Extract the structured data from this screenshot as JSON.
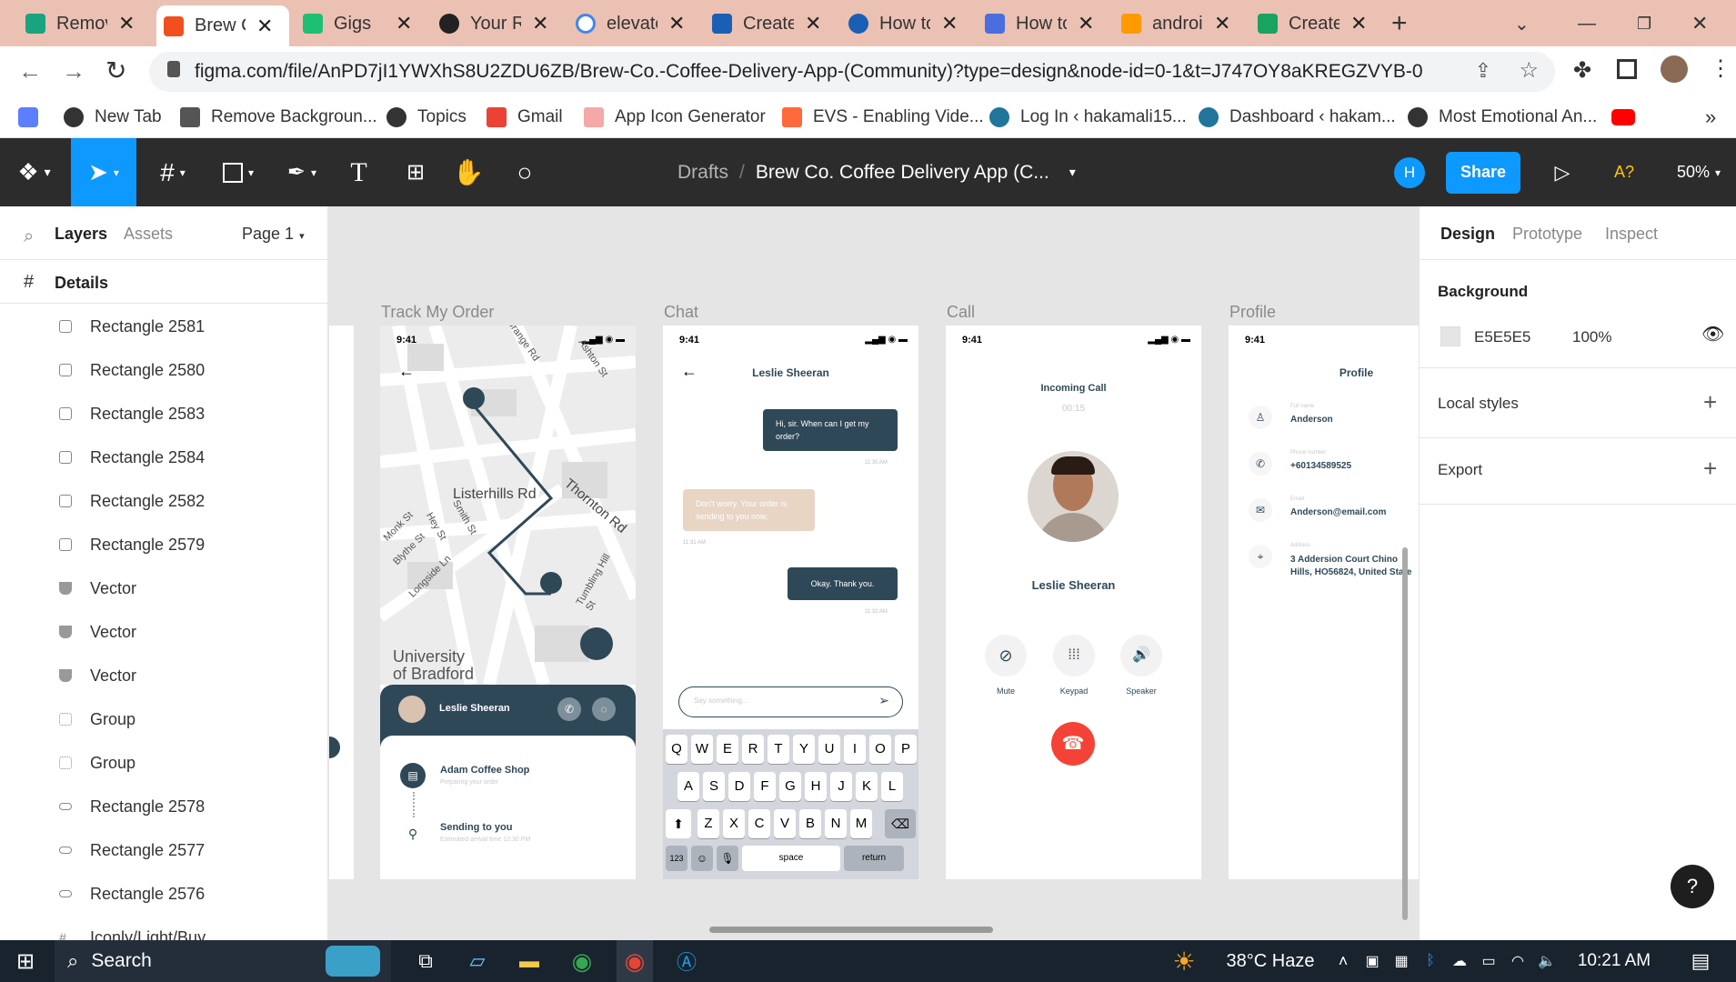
{
  "browser": {
    "tabs": [
      {
        "title": "Remov",
        "color": "#19a37f"
      },
      {
        "title": "Brew C",
        "color": "#f24e1e"
      },
      {
        "title": "Gigs",
        "color": "#1dbf73"
      },
      {
        "title": "Your R",
        "color": "#222222"
      },
      {
        "title": "elevate",
        "color": "#4285f4"
      },
      {
        "title": "Create",
        "color": "#1a5fb4"
      },
      {
        "title": "How to",
        "color": "#1a5fb4"
      },
      {
        "title": "How to",
        "color": "#4a6ee0"
      },
      {
        "title": "androi",
        "color": "#ff9a00"
      },
      {
        "title": "Create",
        "color": "#1aa260"
      }
    ],
    "url": "figma.com/file/AnPD7jI1YWXhS8U2ZDU6ZB/Brew-Co.-Coffee-Delivery-App-(Community)?type=design&node-id=0-1&t=J747OY8aKREGZVYB-0",
    "bookmarks": [
      "New Tab",
      "Remove Backgroun...",
      "Topics",
      "Gmail",
      "App Icon Generator",
      "EVS - Enabling Vide...",
      "Log In ‹ hakamali15...",
      "Dashboard ‹ hakam...",
      "Most Emotional An..."
    ],
    "more": "»"
  },
  "figma": {
    "breadcrumb": {
      "folder": "Drafts",
      "sep": "/",
      "file": "Brew Co. Coffee Delivery App (C..."
    },
    "avatar_letter": "H",
    "share": "Share",
    "a11y": "A?",
    "zoom": "50%"
  },
  "left": {
    "tabs": {
      "layers": "Layers",
      "assets": "Assets",
      "page": "Page 1"
    },
    "frame_name": "Details",
    "layers": [
      "Rectangle 2581",
      "Rectangle 2580",
      "Rectangle 2583",
      "Rectangle 2584",
      "Rectangle 2582",
      "Rectangle 2579",
      "Vector",
      "Vector",
      "Vector",
      "Group",
      "Group",
      "Rectangle 2578",
      "Rectangle 2577",
      "Rectangle 2576",
      "Iconly/Light/Buy"
    ]
  },
  "right": {
    "tabs": {
      "design": "Design",
      "prototype": "Prototype",
      "inspect": "Inspect"
    },
    "background_label": "Background",
    "bg_hex": "E5E5E5",
    "bg_opacity": "100%",
    "local_styles": "Local styles",
    "export": "Export",
    "help": "?"
  },
  "frames": {
    "track": {
      "title": "Track My Order",
      "time": "9:41",
      "streets": [
        "Listerhills Rd",
        "Thornton Rd",
        "Smith St",
        "Hey St",
        "Blythe St",
        "Longside Ln",
        "Tumbling Hill St",
        "Monk St",
        "Ashton St",
        "Grange Rd"
      ],
      "place": "University\nof Bradford",
      "courier": "Leslie Sheeran",
      "shop": "Adam Coffee Shop",
      "shop_sub": "Preparing your order",
      "sending": "Sending to you",
      "sending_sub": "Estimated arrival time 12:30 PM"
    },
    "chat": {
      "title": "Chat",
      "time": "9:41",
      "name": "Leslie Sheeran",
      "msg1": "Hi, sir. When can I get my order?",
      "time1": "11:30 AM",
      "msg2": "Don't worry. Your order is sending to you now.",
      "time2": "11:31 AM",
      "msg3": "Okay. Thank you.",
      "time3": "11:32 AM",
      "placeholder": "Say something...",
      "row1": [
        "Q",
        "W",
        "E",
        "R",
        "T",
        "Y",
        "U",
        "I",
        "O",
        "P"
      ],
      "row2": [
        "A",
        "S",
        "D",
        "F",
        "G",
        "H",
        "J",
        "K",
        "L"
      ],
      "row3": [
        "Z",
        "X",
        "C",
        "V",
        "B",
        "N",
        "M"
      ],
      "k123": "123",
      "space": "space",
      "ret": "return"
    },
    "call": {
      "title": "Call",
      "time": "9:41",
      "incoming": "Incoming Call",
      "timer": "00:15",
      "name": "Leslie Sheeran",
      "mute": "Mute",
      "keypad": "Keypad",
      "speaker": "Speaker"
    },
    "profile": {
      "title": "Profile",
      "time": "9:41",
      "header": "Profile",
      "full_label": "Full name",
      "full": "Anderson",
      "phone_label": "Phone number",
      "phone": "+60134589525",
      "email_label": "Email",
      "email": "Anderson@email.com",
      "addr_label": "Address",
      "addr": "3 Addersion Court Chino Hills, HO56824, United State"
    }
  },
  "taskbar": {
    "search": "Search",
    "weather": "38°C  Haze",
    "time": "10:21 AM"
  },
  "colors": {
    "figma_dark": "#2c2c2c",
    "figma_blue": "#0d99ff",
    "navy": "#2f4858",
    "call_red": "#f44336",
    "tan": "#e8d5c4"
  }
}
